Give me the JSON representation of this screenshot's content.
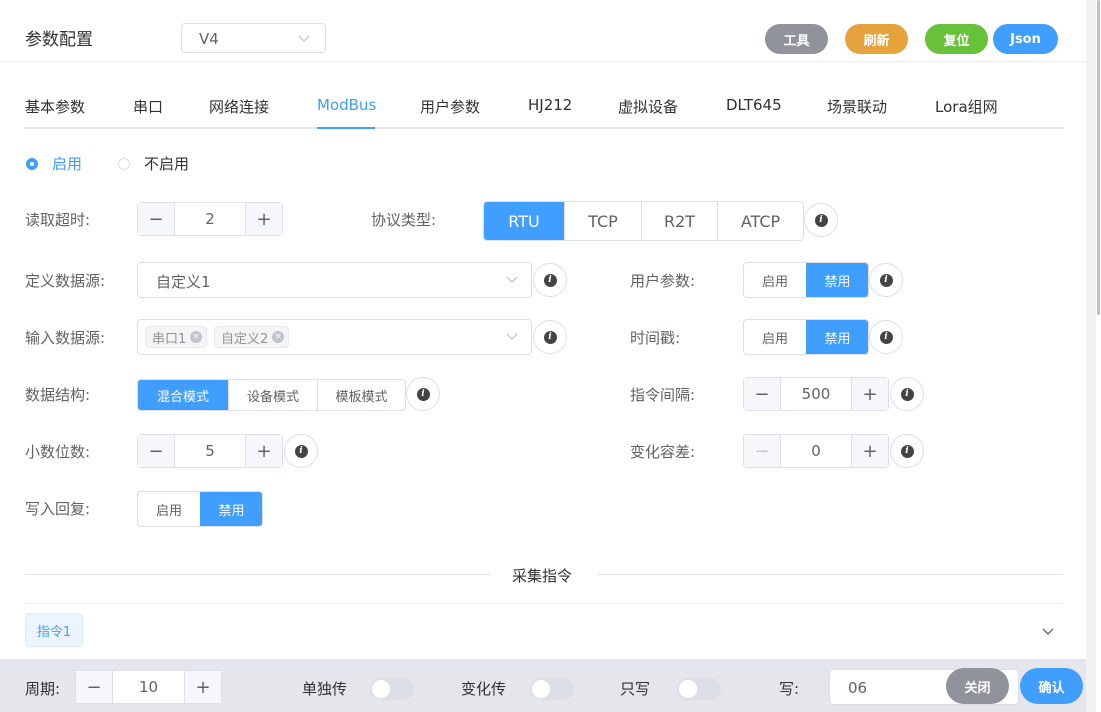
{
  "header": {
    "title": "参数配置",
    "version_selected": "V4",
    "buttons": {
      "tools": "工具",
      "refresh": "刷新",
      "reset": "复位",
      "json": "Json"
    },
    "button_colors": {
      "tools": "#909399",
      "refresh": "#e6a23c",
      "reset": "#67c23a",
      "json": "#409eff"
    }
  },
  "tabs": [
    {
      "label": "基本参数"
    },
    {
      "label": "串口"
    },
    {
      "label": "网络连接"
    },
    {
      "label": "ModBus",
      "active": true
    },
    {
      "label": "用户参数"
    },
    {
      "label": "HJ212"
    },
    {
      "label": "虚拟设备"
    },
    {
      "label": "DLT645"
    },
    {
      "label": "场景联动"
    },
    {
      "label": "Lora组网"
    }
  ],
  "enable": {
    "on": "启用",
    "off": "不启用",
    "selected": "启用"
  },
  "form": {
    "read_timeout": {
      "label": "读取超时:",
      "value": "2"
    },
    "protocol": {
      "label": "协议类型:",
      "options": [
        "RTU",
        "TCP",
        "R2T",
        "ATCP"
      ],
      "selected": "RTU"
    },
    "define_source": {
      "label": "定义数据源:",
      "value": "自定义1"
    },
    "user_params": {
      "label": "用户参数:",
      "options": [
        "启用",
        "禁用"
      ],
      "selected": "禁用"
    },
    "input_source": {
      "label": "输入数据源:",
      "tags": [
        "串口1",
        "自定义2"
      ]
    },
    "timestamp": {
      "label": "时间戳:",
      "options": [
        "启用",
        "禁用"
      ],
      "selected": "禁用"
    },
    "data_structure": {
      "label": "数据结构:",
      "options": [
        "混合模式",
        "设备模式",
        "模板模式"
      ],
      "selected": "混合模式"
    },
    "cmd_interval": {
      "label": "指令间隔:",
      "value": "500"
    },
    "decimals": {
      "label": "小数位数:",
      "value": "5"
    },
    "change_tolerance": {
      "label": "变化容差:",
      "value": "0"
    },
    "write_reply": {
      "label": "写入回复:",
      "options": [
        "启用",
        "禁用"
      ],
      "selected": "禁用"
    }
  },
  "collect": {
    "divider_title": "采集指令",
    "command_badge": "指令1",
    "period": {
      "label": "周期:",
      "value": "10"
    },
    "single_send": "单独传",
    "change_send": "变化传",
    "write_only": "只写",
    "write": {
      "label": "写:",
      "value": "06"
    },
    "close_button": "关闭",
    "confirm_button": "确认"
  }
}
